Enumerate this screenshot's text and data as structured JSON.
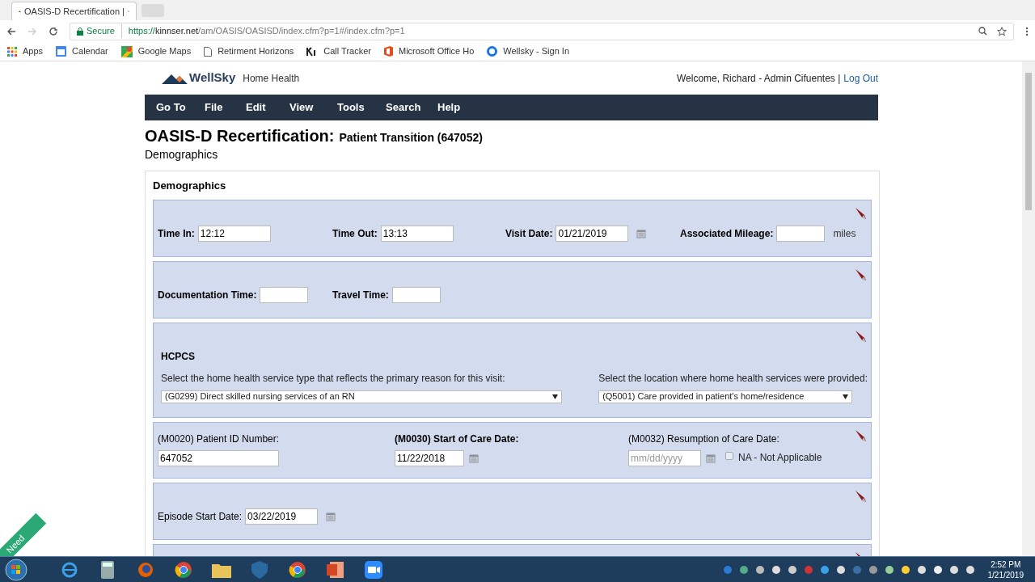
{
  "browser": {
    "tab_title": "OASIS-D Recertification |",
    "url_secure": "Secure",
    "url_scheme": "https://",
    "url_host": "kinnser.net",
    "url_path": "/am/OASIS/OASISD/index.cfm?p=1#/index.cfm?p=1",
    "bookmarks": [
      "Apps",
      "Calendar",
      "Google Maps",
      "Retirment Horizons",
      "Call Tracker",
      "Microsoft Office Ho",
      "Wellsky - Sign In"
    ]
  },
  "header": {
    "brand": "WellSky",
    "product": "Home Health",
    "welcome": "Welcome, Richard - Admin Cifuentes |",
    "logout": "Log Out"
  },
  "menu": [
    "Go To",
    "File",
    "Edit",
    "View",
    "Tools",
    "Search",
    "Help"
  ],
  "page_title": "OASIS-D Recertification:",
  "page_title_detail": "Patient Transition (647052)",
  "page_subtitle": "Demographics",
  "section_title": "Demographics",
  "panels": [
    {
      "kind": "inline",
      "fields": [
        {
          "label": "Time In:",
          "value": "12:12",
          "calendar": false
        },
        {
          "label": "Time Out:",
          "value": "13:13",
          "calendar": false
        },
        {
          "label": "Visit Date:",
          "value": "01/21/2019",
          "calendar": true
        },
        {
          "label": "Associated Mileage:",
          "unit": "miles",
          "calendar": false
        }
      ],
      "bold": true
    },
    {
      "kind": "inline",
      "fields": [
        {
          "label": "Documentation Time:",
          "calendar": false
        },
        {
          "label": "Travel Time:",
          "calendar": false
        }
      ],
      "bold": true
    },
    {
      "kind": "hcpcs",
      "heading": "HCPCS",
      "selects": [
        {
          "label": "Select the home health service type that reflects the primary reason for this visit:",
          "value": "(G0299) Direct skilled nursing services of an RN"
        },
        {
          "label": "Select the location where home health services were provided:",
          "value": "(Q5001) Care provided in patient's home/residence"
        }
      ]
    },
    {
      "kind": "stacked",
      "fields": [
        {
          "label": "(M0020) Patient ID Number:",
          "bold": false,
          "value": "647052",
          "calendar": false
        },
        {
          "label": "(M0030) Start of Care Date:",
          "bold": true,
          "value": "11/22/2018",
          "calendar": true
        },
        {
          "label": "(M0032) Resumption of Care Date:",
          "bold": false,
          "placeholder": "mm/dd/yyyy",
          "calendar": true,
          "checkbox": {
            "label": "NA - Not Applicable",
            "checked": false
          }
        }
      ]
    },
    {
      "kind": "inline",
      "fields": [
        {
          "label": "Episode Start Date:",
          "value": "03/22/2019",
          "calendar": true
        }
      ],
      "bold": false
    },
    {
      "kind": "cut"
    }
  ],
  "help_tab": "Need",
  "clock": {
    "time": "2:52 PM",
    "date": "1/21/2019"
  }
}
